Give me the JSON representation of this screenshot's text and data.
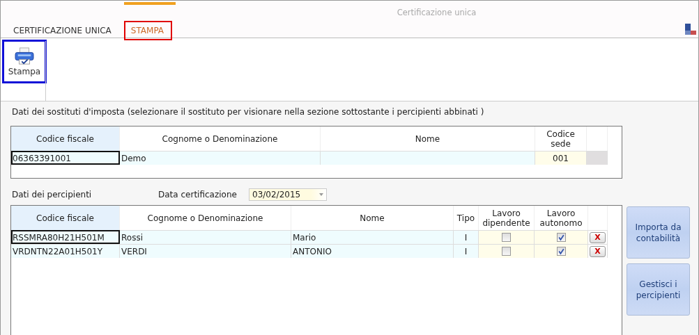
{
  "window": {
    "title": "Certificazione unica"
  },
  "tabs": [
    {
      "label": "CERTIFICAZIONE UNICA",
      "selected": false,
      "highlighted": false
    },
    {
      "label": "STAMPA",
      "selected": true,
      "highlighted": true
    }
  ],
  "ribbon": {
    "buttons": [
      {
        "label": "Stampa",
        "highlighted": true
      }
    ]
  },
  "substitutes": {
    "caption": "Dati dei sostituti d'imposta (selezionare il sostituto per visionare nella sezione sottostante i percipienti abbinati )",
    "columns": [
      "Codice fiscale",
      "Cognome o Denominazione",
      "Nome",
      "Codice sede"
    ],
    "rows": [
      {
        "codice_fiscale": "06363391001",
        "cognome": "Demo",
        "codice_sede": "001",
        "selected": true
      }
    ]
  },
  "recipients": {
    "caption": "Dati dei percipienti",
    "date_label": "Data certificazione",
    "date_value": "03/02/2015",
    "columns": [
      "Codice fiscale",
      "Cognome o Denominazione",
      "Nome",
      "Tipo",
      "Lavoro dipendente",
      "Lavoro autonomo"
    ],
    "rows": [
      {
        "codice_fiscale": "RSSMRA80H21H501M",
        "cognome": "Rossi",
        "nome": "Mario",
        "tipo": "I",
        "lavoro_dipendente": false,
        "lavoro_autonomo": true,
        "selected": true,
        "delete_label": "X"
      },
      {
        "codice_fiscale": "VRDNTN22A01H501Y",
        "cognome": "VERDI",
        "nome": "ANTONIO",
        "tipo": "I",
        "lavoro_dipendente": false,
        "lavoro_autonomo": true,
        "selected": false,
        "delete_label": "X"
      }
    ]
  },
  "side_buttons": [
    "Importa da contabilità",
    "Gestisci i percipienti"
  ]
}
